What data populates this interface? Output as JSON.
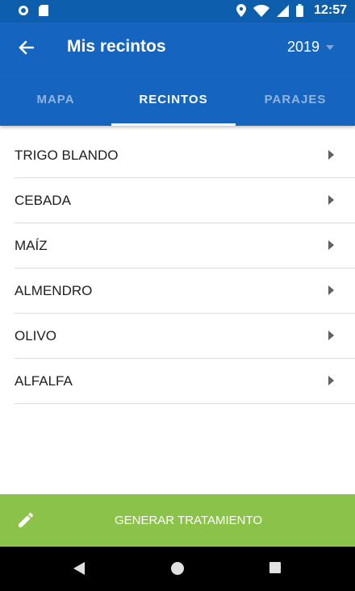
{
  "status_bar": {
    "time": "12:57"
  },
  "header": {
    "title": "Mis recintos",
    "year": "2019"
  },
  "tabs": [
    {
      "label": "MAPA",
      "active": false
    },
    {
      "label": "RECINTOS",
      "active": true
    },
    {
      "label": "PARAJES",
      "active": false
    }
  ],
  "list": {
    "items": [
      "TRIGO BLANDO",
      "CEBADA",
      "MAÍZ",
      "ALMENDRO",
      "OLIVO",
      "ALFALFA"
    ]
  },
  "action": {
    "label": "GENERAR TRATAMIENTO"
  },
  "colors": {
    "primary": "#1565c0",
    "status_bar": "#0d5fae",
    "accent": "#8bc34a"
  },
  "icons": [
    "back-arrow-icon",
    "dropdown-arrow-icon",
    "chevron-right-icon",
    "pencil-icon",
    "nav-back-icon",
    "nav-home-icon",
    "nav-recents-icon"
  ]
}
